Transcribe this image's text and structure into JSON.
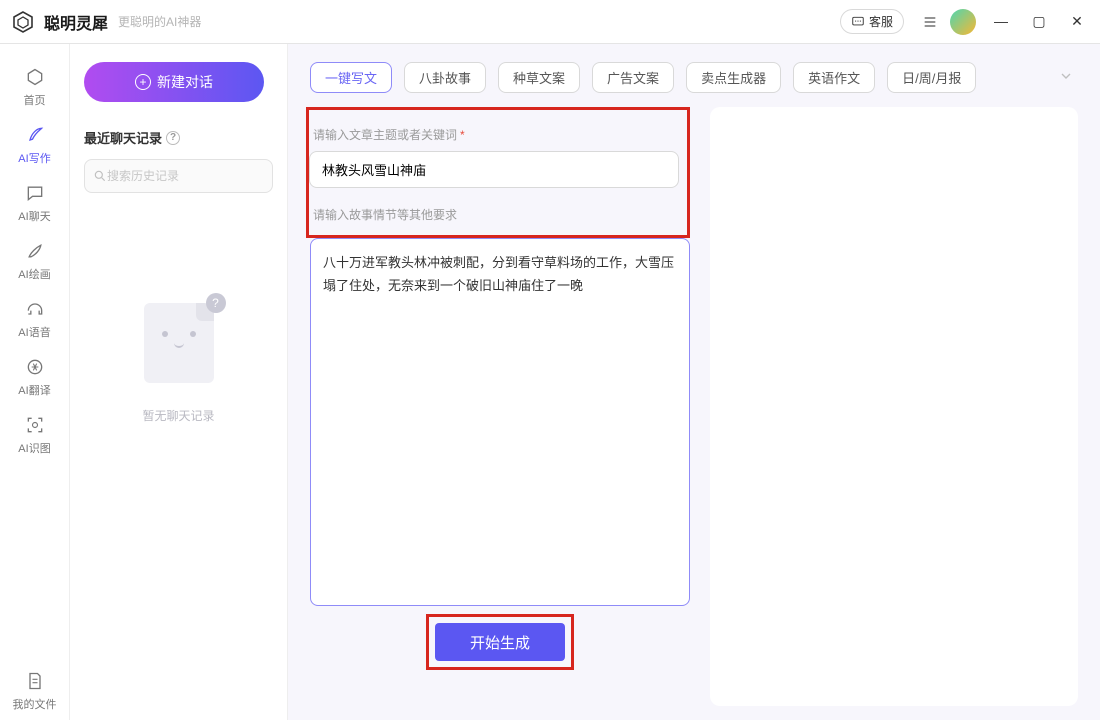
{
  "titlebar": {
    "app_name": "聪明灵犀",
    "app_sub": "更聪明的AI神器",
    "support": "客服"
  },
  "sidebar": {
    "items": [
      {
        "label": "首页"
      },
      {
        "label": "AI写作"
      },
      {
        "label": "AI聊天"
      },
      {
        "label": "AI绘画"
      },
      {
        "label": "AI语音"
      },
      {
        "label": "AI翻译"
      },
      {
        "label": "AI识图"
      }
    ],
    "files_label": "我的文件"
  },
  "panel": {
    "new_chat": "新建对话",
    "history_title": "最近聊天记录",
    "search_placeholder": "搜索历史记录",
    "empty_text": "暂无聊天记录"
  },
  "main": {
    "tags": [
      "一键写文",
      "八卦故事",
      "种草文案",
      "广告文案",
      "卖点生成器",
      "英语作文",
      "日/周/月报"
    ],
    "topic_label": "请输入文章主题或者关键词",
    "topic_value": "林教头风雪山神庙",
    "detail_label": "请输入故事情节等其他要求",
    "detail_value": "八十万进军教头林冲被刺配，分到看守草料场的工作，大雪压塌了住处，无奈来到一个破旧山神庙住了一晚",
    "generate": "开始生成"
  }
}
